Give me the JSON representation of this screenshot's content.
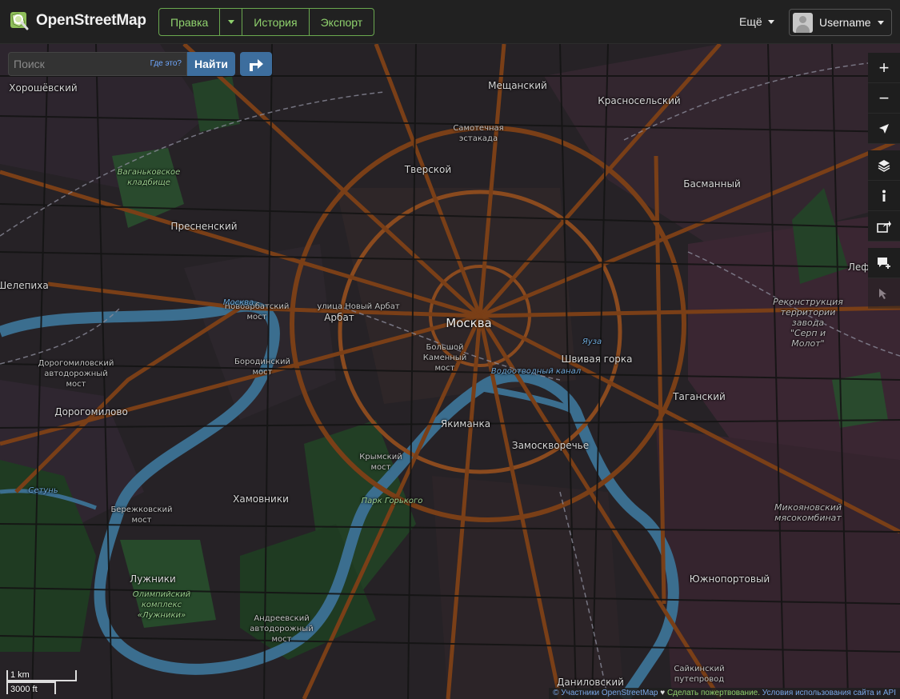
{
  "header": {
    "brand": "OpenStreetMap",
    "nav": {
      "edit": "Правка",
      "history": "История",
      "export": "Экспорт"
    },
    "more": "Ещё",
    "username": "Username"
  },
  "search": {
    "placeholder": "Поиск",
    "where": "Где это?",
    "go": "Найти"
  },
  "labels": {
    "moscow": "Москва",
    "khoroshevsky": "Хорошёвский",
    "meshchansky": "Мещанский",
    "krasnoselsky": "Красносельский",
    "samotechnaya_line1": "Самотечная",
    "samotechnaya_line2": "эстакада",
    "tverskoy": "Тверской",
    "vagankovo_line1": "Ваганьковское",
    "vagankovo_line2": "кладбище",
    "basmanny": "Басманный",
    "presnensky": "Пресненский",
    "lefortovo": "Лефортово",
    "shelepikha": "Шелепиха",
    "novoarbatsky_line1": "Новоарбатский",
    "novoarbatsky_line2": "мост",
    "novy_arbat": "улица Новый Арбат",
    "arbat": "Арбат",
    "bolshoy_line1": "Большой",
    "bolshoy_line2": "Каменный",
    "bolshoy_line3": "мост",
    "borodinsky_line1": "Бородинский",
    "borodinsky_line2": "мост",
    "shvivaya": "Швивая горка",
    "dorogomilovsky_line1": "Дорогомиловский",
    "dorogomilovsky_line2": "автодорожный",
    "dorogomilovsky_line3": "мост",
    "tagansky": "Таганский",
    "dorogomilovo": "Дорогомилово",
    "yakimanka": "Якиманка",
    "zamoskvorechye": "Замоскворечье",
    "krymsky_line1": "Крымский",
    "krymsky_line2": "мост",
    "khamovniki": "Хамовники",
    "berezhkovsky_line1": "Бережковский",
    "berezhkovsky_line2": "мост",
    "park_gorkogo": "Парк Горького",
    "mikoyan_line1": "Микояновский",
    "mikoyan_line2": "мясокомбинат",
    "luzhniki": "Лужники",
    "olymp_line1": "Олимпийский",
    "olymp_line2": "комплекс",
    "olymp_line3": "«Лужники»",
    "yuzhnoportovy": "Южнопортовый",
    "andreevsky_line1": "Андреевский",
    "andreevsky_line2": "автодорожный",
    "andreevsky_line3": "мост",
    "saikinsky_line1": "Сайкинский",
    "saikinsky_line2": "путепровод",
    "danilovsky": "Даниловский",
    "rekon_line1": "Реконструкция",
    "rekon_line2": "территории",
    "rekon_line3": "завода",
    "rekon_line4": "\"Серп и",
    "rekon_line5": "Молот\"",
    "moskva_river": "Москва",
    "setun": "Сетунь",
    "yauza": "Яуза",
    "vodootvodny": "Водоотводный канал"
  },
  "scale": {
    "metric": "1 km",
    "imperial": "3000 ft"
  },
  "attribution": {
    "copyright": "© Участники OpenStreetMap",
    "heart": "♥",
    "donate": "Сделать пожертвование.",
    "terms": "Условия использования сайта и API"
  },
  "colors": {
    "header_bg": "#212121",
    "nav_green": "#8fd16d",
    "map_bg": "#262226",
    "road_major": "#8a4a1e",
    "river": "#3b6e8f",
    "park": "#2a4a2a",
    "button_blue": "#3d6e9e"
  },
  "icons": {
    "logo": "osm-magnifier-logo-icon",
    "directions": "directions-arrow-icon",
    "zoom_in": "plus-icon",
    "zoom_out": "minus-icon",
    "locate": "location-arrow-icon",
    "layers": "layers-icon",
    "info": "info-icon",
    "share": "share-icon",
    "note": "add-note-icon",
    "query": "query-cursor-icon"
  }
}
